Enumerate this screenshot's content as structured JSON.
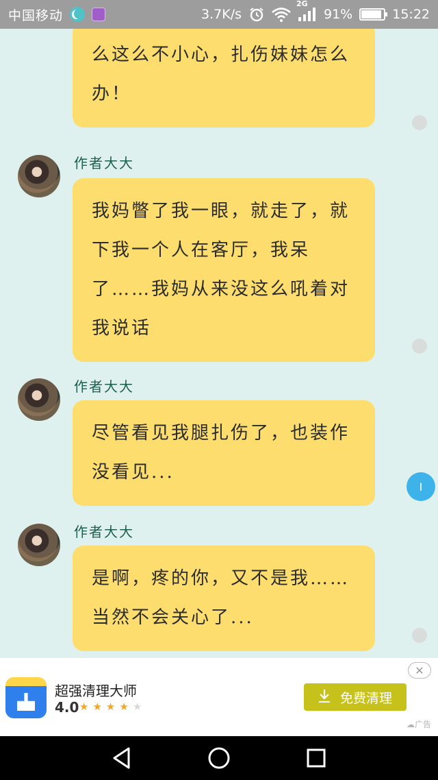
{
  "status_bar": {
    "carrier": "中国移动",
    "speed": "3.7K/s",
    "network": "2G",
    "battery": "91%",
    "battery_level": 0.91,
    "time": "15:22"
  },
  "messages": [
    {
      "author": "",
      "text": "么这么不小心，扎伤妹妹怎么办！"
    },
    {
      "author": "作者大大",
      "text": "我妈瞥了我一眼，就走了，就下我一个人在客厅，我呆了……我妈从来没这么吼着对我说话"
    },
    {
      "author": "作者大大",
      "text": "尽管看见我腿扎伤了，也装作没看见..."
    },
    {
      "author": "作者大大",
      "text": "是啊，疼的你，又不是我……当然不会关心了..."
    }
  ],
  "scroll_button": "I",
  "ad": {
    "title": "超强清理大师",
    "rating": "4.0",
    "rating_value": 4,
    "rating_max": 5,
    "button": "免费清理",
    "ad_label": "广告",
    "close": "✕"
  },
  "icons": {
    "moon": "moon-icon",
    "gallery": "gallery-icon",
    "alarm": "alarm-icon",
    "wifi": "wifi-icon",
    "signal": "signal-icon",
    "download": "download-icon",
    "back": "back-icon",
    "home": "home-icon",
    "recents": "recents-icon"
  }
}
